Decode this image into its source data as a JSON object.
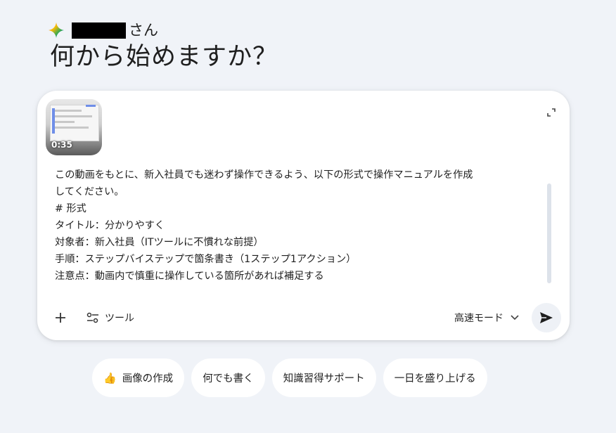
{
  "greeting": {
    "honorific": "さん",
    "headline": "何から始めますか？"
  },
  "prompt_card": {
    "video": {
      "duration": "0:35"
    },
    "text": "この動画をもとに、新入社員でも迷わず操作できるよう、以下の形式で操作マニュアルを作成\nしてください。\n# 形式\nタイトル：分かりやすく\n対象者：新入社員（ITツールに不慣れな前提）\n手順：ステップバイステップで箇条書き（1ステップ1アクション）\n注意点：動画内で慎重に操作している箇所があれば補足する",
    "tools_label": "ツール",
    "mode_label": "高速モード"
  },
  "suggestions": [
    {
      "emoji": "👍",
      "label": "画像の作成"
    },
    {
      "label": "何でも書く"
    },
    {
      "label": "知識習得サポート"
    },
    {
      "label": "一日を盛り上げる"
    }
  ]
}
